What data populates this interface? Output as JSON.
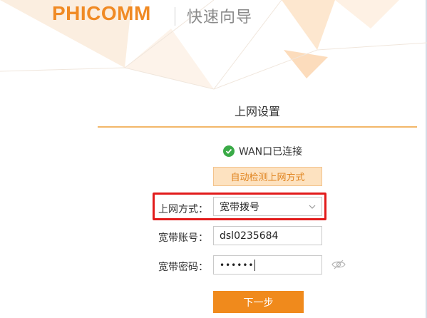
{
  "brand": {
    "logo_text": "PHICOMM",
    "wizard_title": "快速向导"
  },
  "section": {
    "title": "上网设置"
  },
  "status": {
    "icon": "check-circle-icon",
    "text": "WAN口已连接"
  },
  "detect_button": {
    "label": "自动检测上网方式"
  },
  "form": {
    "connection_type": {
      "label": "上网方式：",
      "value": "宽带拨号",
      "icon": "chevron-down-icon"
    },
    "account": {
      "label": "宽带账号：",
      "value": "dsl0235684"
    },
    "password": {
      "label": "宽带密码：",
      "value": "••••••",
      "icon": "eye-off-icon"
    }
  },
  "next_button": {
    "label": "下一步"
  },
  "colors": {
    "brand_orange": "#f08a24",
    "highlight_red": "#e21b1b",
    "success_green": "#3aaa47"
  }
}
